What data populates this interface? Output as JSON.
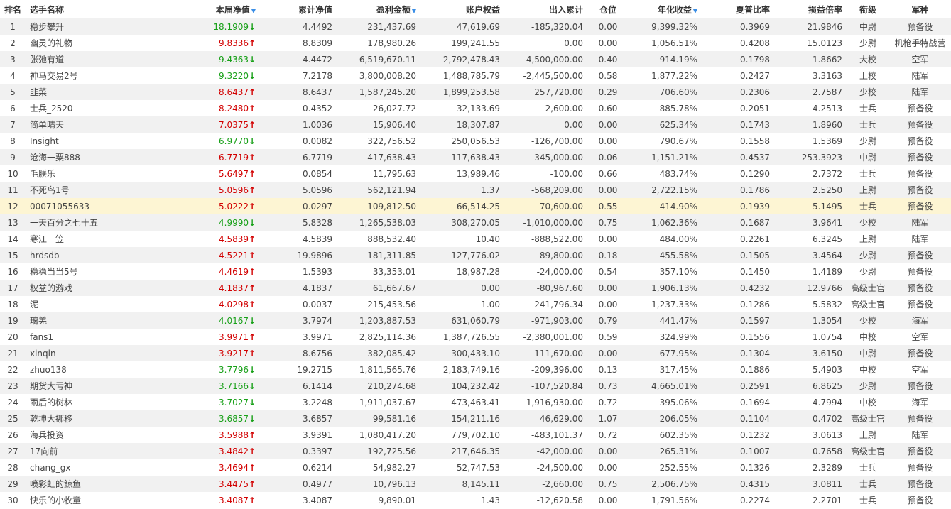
{
  "colors": {
    "up": "#d20000",
    "down": "#18a018",
    "highlight_row": "#fdf5d3",
    "stripe": "#f1f1f1",
    "sort_icon": "#3a8ee6"
  },
  "headers": {
    "rank": "排名",
    "name": "选手名称",
    "weekly_nav": "本届净值",
    "cum_nav": "累计净值",
    "profit": "盈利金额",
    "equity": "账户权益",
    "flow": "出入累计",
    "position": "仓位",
    "annual": "年化收益",
    "sharpe": "夏普比率",
    "pl_ratio": "损益倍率",
    "rank_title": "衔级",
    "branch": "军种"
  },
  "rows": [
    {
      "rank": "1",
      "name": "稳步攀升",
      "nav": "18.1909",
      "dir": "down",
      "cum": "4.4492",
      "profit": "231,437.69",
      "equity": "47,619.69",
      "flow": "-185,320.04",
      "pos": "0.00",
      "annual": "9,399.32%",
      "sharpe": "0.3969",
      "pl": "21.9846",
      "title": "中尉",
      "branch": "预备役"
    },
    {
      "rank": "2",
      "name": "幽灵的礼物",
      "nav": "9.8336",
      "dir": "up",
      "cum": "8.8309",
      "profit": "178,980.26",
      "equity": "199,241.55",
      "flow": "0.00",
      "pos": "0.00",
      "annual": "1,056.51%",
      "sharpe": "0.4208",
      "pl": "15.0123",
      "title": "少尉",
      "branch": "机枪手特战营"
    },
    {
      "rank": "3",
      "name": "张弛有道",
      "nav": "9.4363",
      "dir": "down",
      "cum": "4.4472",
      "profit": "6,519,670.11",
      "equity": "2,792,478.43",
      "flow": "-4,500,000.00",
      "pos": "0.40",
      "annual": "914.19%",
      "sharpe": "0.1798",
      "pl": "1.8662",
      "title": "大校",
      "branch": "空军"
    },
    {
      "rank": "4",
      "name": "神马交易2号",
      "nav": "9.3220",
      "dir": "down",
      "cum": "7.2178",
      "profit": "3,800,008.20",
      "equity": "1,488,785.79",
      "flow": "-2,445,500.00",
      "pos": "0.58",
      "annual": "1,877.22%",
      "sharpe": "0.2427",
      "pl": "3.3163",
      "title": "上校",
      "branch": "陆军"
    },
    {
      "rank": "5",
      "name": "韭菜",
      "nav": "8.6437",
      "dir": "up",
      "cum": "8.6437",
      "profit": "1,587,245.20",
      "equity": "1,899,253.58",
      "flow": "257,720.00",
      "pos": "0.29",
      "annual": "706.60%",
      "sharpe": "0.2306",
      "pl": "2.7587",
      "title": "少校",
      "branch": "陆军"
    },
    {
      "rank": "6",
      "name": "士兵_2520",
      "nav": "8.2480",
      "dir": "up",
      "cum": "0.4352",
      "profit": "26,027.72",
      "equity": "32,133.69",
      "flow": "2,600.00",
      "pos": "0.60",
      "annual": "885.78%",
      "sharpe": "0.2051",
      "pl": "4.2513",
      "title": "士兵",
      "branch": "预备役"
    },
    {
      "rank": "7",
      "name": "简单晴天",
      "nav": "7.0375",
      "dir": "up",
      "cum": "1.0036",
      "profit": "15,906.40",
      "equity": "18,307.87",
      "flow": "0.00",
      "pos": "0.00",
      "annual": "625.34%",
      "sharpe": "0.1743",
      "pl": "1.8960",
      "title": "士兵",
      "branch": "预备役"
    },
    {
      "rank": "8",
      "name": "Insight",
      "nav": "6.9770",
      "dir": "down",
      "cum": "0.0082",
      "profit": "322,756.52",
      "equity": "250,056.53",
      "flow": "-126,700.00",
      "pos": "0.00",
      "annual": "790.67%",
      "sharpe": "0.1558",
      "pl": "1.5369",
      "title": "少尉",
      "branch": "预备役"
    },
    {
      "rank": "9",
      "name": "沧海一粟888",
      "nav": "6.7719",
      "dir": "up",
      "cum": "6.7719",
      "profit": "417,638.43",
      "equity": "117,638.43",
      "flow": "-345,000.00",
      "pos": "0.06",
      "annual": "1,151.21%",
      "sharpe": "0.4537",
      "pl": "253.3923",
      "title": "中尉",
      "branch": "预备役"
    },
    {
      "rank": "10",
      "name": "毛朕乐",
      "nav": "5.6497",
      "dir": "up",
      "cum": "0.0854",
      "profit": "11,795.63",
      "equity": "13,989.46",
      "flow": "-100.00",
      "pos": "0.66",
      "annual": "483.74%",
      "sharpe": "0.1290",
      "pl": "2.7372",
      "title": "士兵",
      "branch": "预备役"
    },
    {
      "rank": "11",
      "name": "不死鸟1号",
      "nav": "5.0596",
      "dir": "up",
      "cum": "5.0596",
      "profit": "562,121.94",
      "equity": "1.37",
      "flow": "-568,209.00",
      "pos": "0.00",
      "annual": "2,722.15%",
      "sharpe": "0.1786",
      "pl": "2.5250",
      "title": "上尉",
      "branch": "预备役"
    },
    {
      "rank": "12",
      "name": "00071055633",
      "nav": "5.0222",
      "dir": "up",
      "cum": "0.0297",
      "profit": "109,812.50",
      "equity": "66,514.25",
      "flow": "-70,600.00",
      "pos": "0.55",
      "annual": "414.90%",
      "sharpe": "0.1939",
      "pl": "5.1495",
      "title": "士兵",
      "branch": "预备役"
    },
    {
      "rank": "13",
      "name": "一天百分之七十五",
      "nav": "4.9990",
      "dir": "down",
      "cum": "5.8328",
      "profit": "1,265,538.03",
      "equity": "308,270.05",
      "flow": "-1,010,000.00",
      "pos": "0.75",
      "annual": "1,062.36%",
      "sharpe": "0.1687",
      "pl": "3.9641",
      "title": "少校",
      "branch": "陆军"
    },
    {
      "rank": "14",
      "name": "寒江一笠",
      "nav": "4.5839",
      "dir": "up",
      "cum": "4.5839",
      "profit": "888,532.40",
      "equity": "10.40",
      "flow": "-888,522.00",
      "pos": "0.00",
      "annual": "484.00%",
      "sharpe": "0.2261",
      "pl": "6.3245",
      "title": "上尉",
      "branch": "陆军"
    },
    {
      "rank": "15",
      "name": "hrdsdb",
      "nav": "4.5221",
      "dir": "up",
      "cum": "19.9896",
      "profit": "181,311.85",
      "equity": "127,776.02",
      "flow": "-89,800.00",
      "pos": "0.18",
      "annual": "455.58%",
      "sharpe": "0.1505",
      "pl": "3.4564",
      "title": "少尉",
      "branch": "预备役"
    },
    {
      "rank": "16",
      "name": "稳稳当当5号",
      "nav": "4.4619",
      "dir": "up",
      "cum": "1.5393",
      "profit": "33,353.01",
      "equity": "18,987.28",
      "flow": "-24,000.00",
      "pos": "0.54",
      "annual": "357.10%",
      "sharpe": "0.1450",
      "pl": "1.4189",
      "title": "少尉",
      "branch": "预备役"
    },
    {
      "rank": "17",
      "name": "权益的游戏",
      "nav": "4.1837",
      "dir": "up",
      "cum": "4.1837",
      "profit": "61,667.67",
      "equity": "0.00",
      "flow": "-80,967.60",
      "pos": "0.00",
      "annual": "1,906.13%",
      "sharpe": "0.4232",
      "pl": "12.9766",
      "title": "高级士官",
      "branch": "预备役"
    },
    {
      "rank": "18",
      "name": "泥",
      "nav": "4.0298",
      "dir": "up",
      "cum": "0.0037",
      "profit": "215,453.56",
      "equity": "1.00",
      "flow": "-241,796.34",
      "pos": "0.00",
      "annual": "1,237.33%",
      "sharpe": "0.1286",
      "pl": "5.5832",
      "title": "高级士官",
      "branch": "预备役"
    },
    {
      "rank": "19",
      "name": "璃羌",
      "nav": "4.0167",
      "dir": "down",
      "cum": "3.7974",
      "profit": "1,203,887.53",
      "equity": "631,060.79",
      "flow": "-971,903.00",
      "pos": "0.79",
      "annual": "441.47%",
      "sharpe": "0.1597",
      "pl": "1.3054",
      "title": "少校",
      "branch": "海军"
    },
    {
      "rank": "20",
      "name": "fans1",
      "nav": "3.9971",
      "dir": "up",
      "cum": "3.9971",
      "profit": "2,825,114.36",
      "equity": "1,387,726.55",
      "flow": "-2,380,001.00",
      "pos": "0.59",
      "annual": "324.99%",
      "sharpe": "0.1556",
      "pl": "1.0754",
      "title": "中校",
      "branch": "空军"
    },
    {
      "rank": "21",
      "name": "xinqin",
      "nav": "3.9217",
      "dir": "up",
      "cum": "8.6756",
      "profit": "382,085.42",
      "equity": "300,433.10",
      "flow": "-111,670.00",
      "pos": "0.00",
      "annual": "677.95%",
      "sharpe": "0.1304",
      "pl": "3.6150",
      "title": "中尉",
      "branch": "预备役"
    },
    {
      "rank": "22",
      "name": "zhuo138",
      "nav": "3.7796",
      "dir": "down",
      "cum": "19.2715",
      "profit": "1,811,565.76",
      "equity": "2,183,749.16",
      "flow": "-209,396.00",
      "pos": "0.13",
      "annual": "317.45%",
      "sharpe": "0.1886",
      "pl": "5.4903",
      "title": "中校",
      "branch": "空军"
    },
    {
      "rank": "23",
      "name": "期货大亏神",
      "nav": "3.7166",
      "dir": "down",
      "cum": "6.1414",
      "profit": "210,274.68",
      "equity": "104,232.42",
      "flow": "-107,520.84",
      "pos": "0.73",
      "annual": "4,665.01%",
      "sharpe": "0.2591",
      "pl": "6.8625",
      "title": "少尉",
      "branch": "预备役"
    },
    {
      "rank": "24",
      "name": "雨后的树林",
      "nav": "3.7027",
      "dir": "down",
      "cum": "3.2248",
      "profit": "1,911,037.67",
      "equity": "473,463.41",
      "flow": "-1,916,930.00",
      "pos": "0.72",
      "annual": "395.06%",
      "sharpe": "0.1694",
      "pl": "4.7994",
      "title": "中校",
      "branch": "海军"
    },
    {
      "rank": "25",
      "name": "乾坤大挪移",
      "nav": "3.6857",
      "dir": "down",
      "cum": "3.6857",
      "profit": "99,581.16",
      "equity": "154,211.16",
      "flow": "46,629.00",
      "pos": "1.07",
      "annual": "206.05%",
      "sharpe": "0.1104",
      "pl": "0.4702",
      "title": "高级士官",
      "branch": "预备役"
    },
    {
      "rank": "26",
      "name": "海兵投资",
      "nav": "3.5988",
      "dir": "up",
      "cum": "3.9391",
      "profit": "1,080,417.20",
      "equity": "779,702.10",
      "flow": "-483,101.37",
      "pos": "0.72",
      "annual": "602.35%",
      "sharpe": "0.1232",
      "pl": "3.0613",
      "title": "上尉",
      "branch": "陆军"
    },
    {
      "rank": "27",
      "name": "17向前",
      "nav": "3.4842",
      "dir": "up",
      "cum": "0.3397",
      "profit": "192,725.56",
      "equity": "217,646.35",
      "flow": "-42,000.00",
      "pos": "0.00",
      "annual": "265.31%",
      "sharpe": "0.1007",
      "pl": "0.7658",
      "title": "高级士官",
      "branch": "预备役"
    },
    {
      "rank": "28",
      "name": "chang_gx",
      "nav": "3.4694",
      "dir": "up",
      "cum": "0.6214",
      "profit": "54,982.27",
      "equity": "52,747.53",
      "flow": "-24,500.00",
      "pos": "0.00",
      "annual": "252.55%",
      "sharpe": "0.1326",
      "pl": "2.3289",
      "title": "士兵",
      "branch": "预备役"
    },
    {
      "rank": "29",
      "name": "喷彩虹的鲸鱼",
      "nav": "3.4475",
      "dir": "up",
      "cum": "0.4977",
      "profit": "10,796.13",
      "equity": "8,145.11",
      "flow": "-2,660.00",
      "pos": "0.75",
      "annual": "2,506.75%",
      "sharpe": "0.4315",
      "pl": "3.0811",
      "title": "士兵",
      "branch": "预备役"
    },
    {
      "rank": "30",
      "name": "快乐的小牧童",
      "nav": "3.4087",
      "dir": "up",
      "cum": "3.4087",
      "profit": "9,890.01",
      "equity": "1.43",
      "flow": "-12,620.58",
      "pos": "0.00",
      "annual": "1,791.56%",
      "sharpe": "0.2274",
      "pl": "2.2701",
      "title": "士兵",
      "branch": "预备役"
    }
  ],
  "highlighted_rank": "12"
}
